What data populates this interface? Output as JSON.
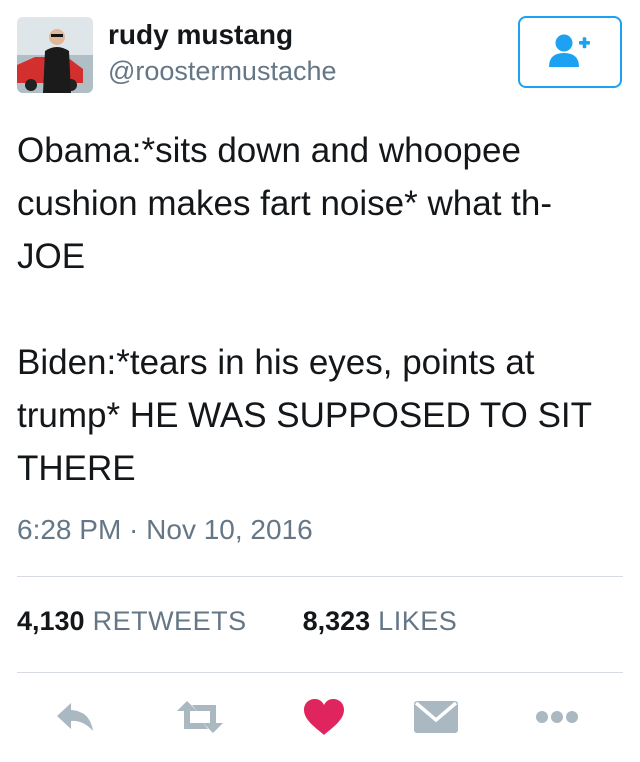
{
  "user": {
    "display_name": "rudy mustang",
    "handle": "@roostermustache"
  },
  "follow_button": {
    "icon": "add-user-icon",
    "color": "#1da1f2"
  },
  "tweet": {
    "paragraphs": [
      "Obama:*sits down and whoopee\ncushion makes fart noise* what th-\nJOE",
      "Biden:*tears in his eyes, points at\ntrump* HE WAS SUPPOSED TO SIT\nTHERE"
    ],
    "timestamp": "6:28 PM · Nov 10, 2016"
  },
  "stats": {
    "retweets_count": "4,130",
    "retweets_label": "RETWEETS",
    "likes_count": "8,323",
    "likes_label": "LIKES"
  },
  "actions": [
    {
      "icon": "reply-icon"
    },
    {
      "icon": "retweet-icon"
    },
    {
      "icon": "heart-icon",
      "color": "#e0245e"
    },
    {
      "icon": "direct-message-icon"
    },
    {
      "icon": "more-icon"
    }
  ],
  "colors": {
    "text": "#14171a",
    "secondary": "#657786",
    "accent": "#1da1f2",
    "like": "#e0245e",
    "icon": "#aab8c2"
  }
}
